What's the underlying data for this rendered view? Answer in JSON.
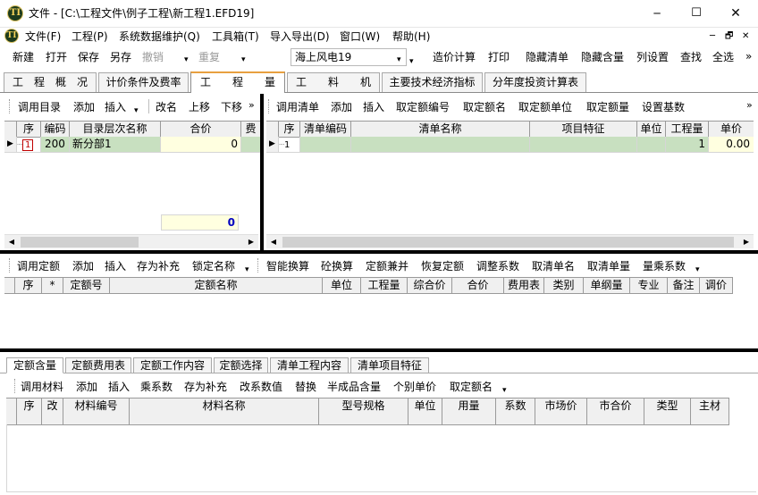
{
  "window": {
    "title": "文件 - [C:\\工程文件\\例子工程\\新工程1.EFD19]",
    "minimize": "─",
    "maximize": "☐",
    "close": "✕"
  },
  "menubar": {
    "items": [
      "文件(F)",
      "工程(P)",
      "系统数据维护(Q)",
      "工具箱(T)",
      "导入导出(D)",
      "窗口(W)",
      "帮助(H)"
    ],
    "child_controls": [
      "─",
      "🗗",
      "✕"
    ]
  },
  "toolbar": {
    "new": "新建",
    "open": "打开",
    "save": "保存",
    "saveas": "另存",
    "undo": "撤销",
    "redo": "重复",
    "project_select": "海上风电19",
    "calc": "造价计算",
    "print": "打印",
    "hide_list": "隐藏清单",
    "hide_content": "隐藏含量",
    "col_settings": "列设置",
    "find": "查找",
    "select_all": "全选",
    "more": "»"
  },
  "main_tabs": [
    "工　程　概　况",
    "计价条件及费率",
    "工　　程　　量",
    "工　　料　　机",
    "主要技术经济指标",
    "分年度投资计算表"
  ],
  "left_toolbar": {
    "items": [
      "调用目录",
      "添加",
      "插入"
    ],
    "items2": [
      "改名",
      "上移",
      "下移"
    ],
    "more": "»"
  },
  "left_grid": {
    "headers": [
      "序",
      "编码",
      "目录层次名称",
      "合价",
      "费"
    ],
    "rows": [
      {
        "seq": "1",
        "code": "200",
        "name": "新分部1",
        "total": "0"
      }
    ],
    "footer_total": "0"
  },
  "right_toolbar": {
    "items": [
      "调用清单",
      "添加",
      "插入",
      "取定额编号",
      "取定额名",
      "取定额单位",
      "取定额量",
      "设置基数"
    ],
    "more": "»"
  },
  "right_grid": {
    "headers": [
      "序",
      "清单编码",
      "清单名称",
      "项目特征",
      "单位",
      "工程量",
      "单价"
    ],
    "rows": [
      {
        "seq": "1",
        "quantity": "1",
        "price": "0.00"
      }
    ]
  },
  "middle_toolbar": {
    "items": [
      "调用定额",
      "添加",
      "插入",
      "存为补充",
      "锁定名称"
    ],
    "items2": [
      "智能换算",
      "砼换算",
      "定额兼并",
      "恢复定额",
      "调整系数",
      "取清单名",
      "取清单量",
      "量乘系数"
    ]
  },
  "middle_grid": {
    "headers": [
      "序",
      "*",
      "定额号",
      "定额名称",
      "单位",
      "工程量",
      "综合价",
      "合价",
      "费用表",
      "类别",
      "单纲量",
      "专业",
      "备注",
      "调价"
    ]
  },
  "bottom_tabs": [
    "定额含量",
    "定额费用表",
    "定额工作内容",
    "定额选择",
    "清单工程内容",
    "清单项目特征"
  ],
  "bottom_toolbar": {
    "items": [
      "调用材料",
      "添加",
      "插入",
      "乘系数",
      "存为补充",
      "改系数值",
      "替换",
      "半成品含量",
      "个别单价",
      "取定额名"
    ]
  },
  "bottom_grid": {
    "headers": [
      "序",
      "改",
      "材料编号",
      "材料名称",
      "型号规格",
      "单位",
      "用量",
      "系数",
      "市场价",
      "市合价",
      "类型",
      "主材"
    ]
  },
  "colors": {
    "title_bg": "#ffffff",
    "accent_green": "#c8e0c0",
    "yellow_cell": "#ffffe0",
    "divider": "#000000",
    "sum_blue": "#0000c0"
  },
  "icons": {
    "app": "app-logo-icon"
  }
}
